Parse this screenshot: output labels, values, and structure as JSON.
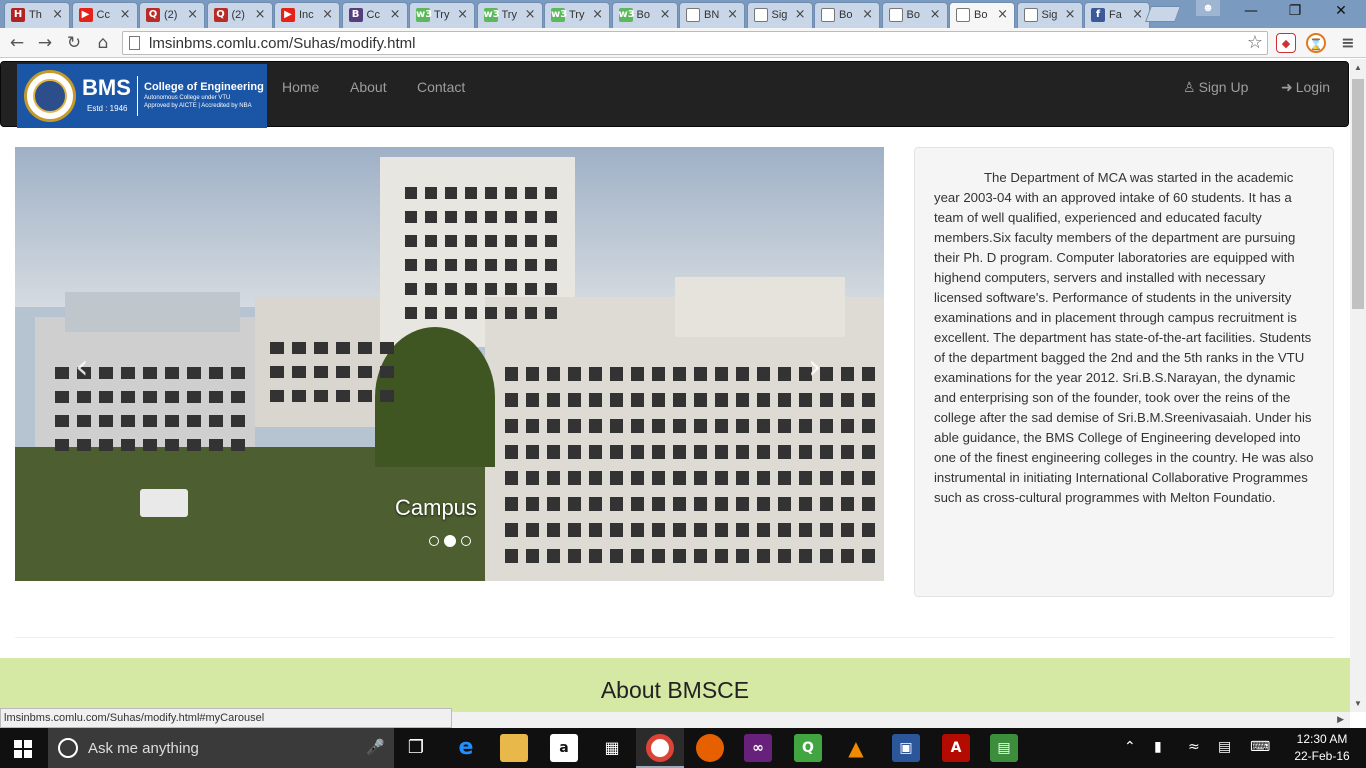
{
  "browser": {
    "tabs": [
      {
        "title": "Th",
        "favicon": "H",
        "color": "#b22222"
      },
      {
        "title": "Cc",
        "favicon": "▶",
        "color": "#e62117"
      },
      {
        "title": "(2)",
        "favicon": "Q",
        "color": "#b92b27"
      },
      {
        "title": "(2)",
        "favicon": "Q",
        "color": "#b92b27"
      },
      {
        "title": "Inc",
        "favicon": "▶",
        "color": "#e62117"
      },
      {
        "title": "Cc",
        "favicon": "B",
        "color": "#563d7c"
      },
      {
        "title": "Try",
        "favicon": "w3",
        "color": "#5cb85c"
      },
      {
        "title": "Try",
        "favicon": "w3",
        "color": "#5cb85c"
      },
      {
        "title": "Try",
        "favicon": "w3",
        "color": "#5cb85c"
      },
      {
        "title": "Bo",
        "favicon": "w3",
        "color": "#5cb85c"
      },
      {
        "title": "BN",
        "favicon": "",
        "color": "#ffffff"
      },
      {
        "title": "Sig",
        "favicon": "",
        "color": "#ffffff"
      },
      {
        "title": "Bo",
        "favicon": "",
        "color": "#ffffff"
      },
      {
        "title": "Bo",
        "favicon": "",
        "color": "#ffffff"
      },
      {
        "title": "Bo",
        "favicon": "",
        "color": "#ffffff",
        "active": true
      },
      {
        "title": "Sig",
        "favicon": "",
        "color": "#ffffff"
      },
      {
        "title": "Fa",
        "favicon": "f",
        "color": "#3b5998"
      }
    ],
    "url": "lmsinbms.comlu.com/Suhas/modify.html",
    "status_url": "lmsinbms.comlu.com/Suhas/modify.html#myCarousel"
  },
  "site": {
    "logo": {
      "abbr": "BMS",
      "estd": "Estd : 1946",
      "name": "College of Engineering",
      "line1": "Autonomous College under VTU",
      "line2": "Approved by AICTE | Accredited by NBA"
    },
    "nav": {
      "home": "Home",
      "about": "About",
      "contact": "Contact",
      "signup": "Sign Up",
      "login": "Login"
    },
    "carousel": {
      "caption": "Campus",
      "slide_count": 3,
      "active_slide": 2
    },
    "info_text": "The Department of MCA was started in the academic year 2003-04 with an approved intake of 60 students. It has a team of well qualified, experienced and educated faculty members.Six faculty members of the department are pursuing their Ph. D program. Computer laboratories are equipped with highend computers, servers and installed with necessary licensed software's. Performance of students in the university examinations and in placement through campus recruitment is excellent. The department has state-of-the-art facilities. Students of the department bagged the 2nd and the 5th ranks in the VTU examinations for the year 2012. Sri.B.S.Narayan, the dynamic and enterprising son of the founder, took over the reins of the college after the sad demise of Sri.B.M.Sreenivasaiah. Under his able guidance, the BMS College of Engineering developed into one of the finest engineering colleges in the country.  He was also instrumental in initiating International Collaborative Programmes such as cross-cultural programmes with Melton Foundatio.",
    "about_heading": "About BMSCE",
    "colors": {
      "navbar": "#222222",
      "about_band": "#d5e8a4",
      "logo_bg": "#1b55a6"
    }
  },
  "taskbar": {
    "search_placeholder": "Ask me anything",
    "time": "12:30 AM",
    "date": "22-Feb-16"
  }
}
